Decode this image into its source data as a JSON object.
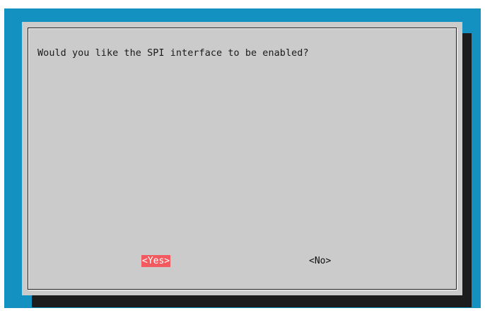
{
  "dialog": {
    "message": "Would you like the SPI interface to be enabled?",
    "buttons": {
      "yes_label": "<Yes>",
      "no_label": "<No>"
    },
    "selected_button": "yes"
  },
  "colors": {
    "background": "#1391c1",
    "dialog_body": "#cbcbcb",
    "shadow": "#1c1c1c",
    "selected_button_bg": "#f25a5f",
    "selected_button_text": "#ffffff"
  }
}
